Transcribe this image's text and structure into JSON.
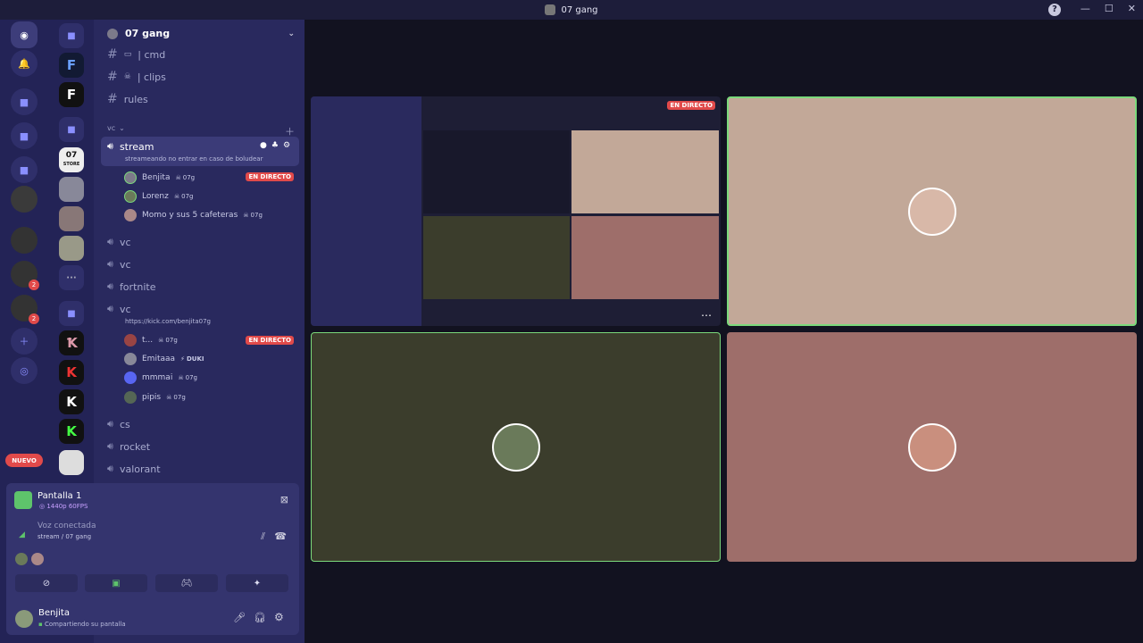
{
  "window": {
    "title": "07 gang"
  },
  "server": {
    "name": "07 gang"
  },
  "channels": {
    "text": [
      {
        "name": "| cmd"
      },
      {
        "name": "| clips"
      },
      {
        "name": "rules"
      }
    ],
    "category": "vc",
    "voice_stream": {
      "name": "stream",
      "status": "streameando no entrar en caso de boludear",
      "members": [
        {
          "name": "Benjita",
          "tag": "07g",
          "live": "EN DIRECTO"
        },
        {
          "name": "Lorenz",
          "tag": "07g"
        },
        {
          "name": "Momo y sus 5 cafeteras",
          "tag": "07g"
        }
      ]
    },
    "voice_list_1": [
      "vc",
      "vc",
      "fortnite"
    ],
    "voice_vc": {
      "name": "vc",
      "status": "https://kick.com/benjita07g",
      "members": [
        {
          "name": "t...",
          "tag": "07g",
          "live": "EN DIRECTO"
        },
        {
          "name": "Emitaaa",
          "tag": "DUKI"
        },
        {
          "name": "mmmai",
          "tag": "07g"
        },
        {
          "name": "pipis",
          "tag": "07g"
        }
      ]
    },
    "voice_list_2": [
      "cs",
      "rocket",
      "valorant"
    ]
  },
  "servers": {
    "nuevo": "NUEVO",
    "badge_1": "2",
    "badge_2": "2",
    "store_label": "07",
    "store_sub": "STORE"
  },
  "stream_panel": {
    "title": "Pantalla 1",
    "quality": "1440p 60FPS",
    "voice_status": "Voz conectada",
    "voice_location": "stream / 07 gang"
  },
  "user": {
    "name": "Benjita",
    "status": "Compartiendo su pantalla"
  },
  "stage": {
    "live_label": "EN DIRECTO",
    "more": "⋯"
  },
  "colors": {
    "accent": "#5865f2",
    "live": "#e14a4a",
    "speaking": "#7bd97b"
  }
}
